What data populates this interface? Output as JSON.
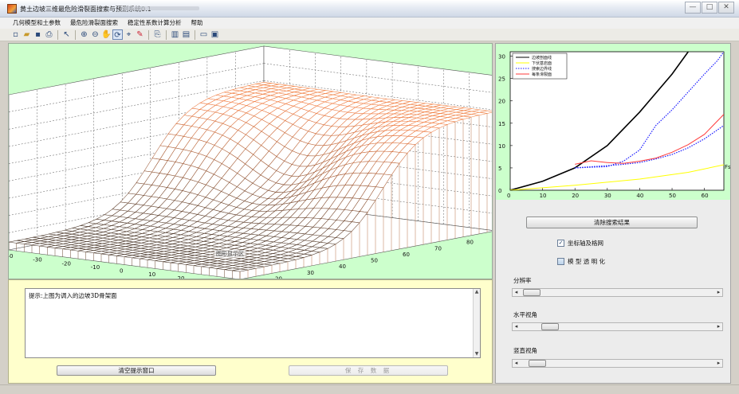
{
  "window": {
    "title": "黄土边坡三维最危险滑裂面搜索与预测系统0.1",
    "minimize": "—",
    "maximize": "□",
    "close": "✕"
  },
  "menu": [
    "几何模型和土参数",
    "最危险滑裂面搜索",
    "稳定性系数计算分析",
    "帮助"
  ],
  "toolbar": {
    "icons": [
      "new-file-icon",
      "open-folder-icon",
      "save-icon",
      "print-icon",
      "pointer-icon",
      "zoom-in-icon",
      "zoom-out-icon",
      "pan-icon",
      "rotate-3d-icon",
      "data-cursor-icon",
      "brush-icon",
      "link-icon",
      "colorbar-icon",
      "legend-icon",
      "hide-plot-tools-icon",
      "show-plot-tools-icon"
    ]
  },
  "plot3d": {
    "x_ticks": [
      "-40",
      "-30",
      "-20",
      "-10",
      "0",
      "10",
      "20",
      "30",
      "40"
    ],
    "y_ticks": [
      "10",
      "20",
      "30",
      "40",
      "50",
      "60",
      "70",
      "80",
      "90"
    ],
    "overlay_label": "图形显示区",
    "colors": {
      "mesh": "#b05a2a",
      "grid": "#333333",
      "background": "#ffffff"
    }
  },
  "plot2d": {
    "chart_data": {
      "type": "line",
      "xlim": [
        0,
        66
      ],
      "ylim": [
        0,
        31
      ],
      "x_ticks": [
        "0",
        "10",
        "20",
        "30",
        "40",
        "50",
        "60"
      ],
      "y_ticks": [
        "0",
        "5",
        "10",
        "15",
        "20",
        "25",
        "30"
      ],
      "grid": false,
      "legend_position": "top-left",
      "xlabel_partial": "Fs",
      "series": [
        {
          "name": "边坡剖面线",
          "color": "#000000",
          "dash": "solid",
          "x": [
            0,
            10,
            20,
            30,
            40,
            50,
            55
          ],
          "y": [
            0,
            2,
            5,
            10,
            17.5,
            26,
            31
          ]
        },
        {
          "name": "下伏基岩面",
          "color": "#ffff00",
          "dash": "solid",
          "x": [
            0,
            20,
            40,
            55,
            66
          ],
          "y": [
            0,
            1.1,
            2.5,
            4,
            5.7
          ]
        },
        {
          "name": "搜索边界线",
          "color": "#1a1aff",
          "dash": "dotted",
          "x": [
            20,
            30,
            35,
            40,
            45,
            50,
            55,
            60,
            64,
            66
          ],
          "y": [
            5,
            5.3,
            6.5,
            9,
            14.5,
            18,
            22,
            26,
            29,
            31
          ]
        },
        {
          "name": "每条滑裂面",
          "color": "#ff3b3b",
          "dash": "solid",
          "x": [
            20,
            25,
            30,
            35,
            40,
            45,
            50,
            55,
            60,
            66
          ],
          "y": [
            5.8,
            6.6,
            6.2,
            6.0,
            6.5,
            7.2,
            8.5,
            10.2,
            12.5,
            17
          ]
        },
        {
          "name": "",
          "color": "#1a1aff",
          "dash": "dotted",
          "x": [
            20,
            30,
            35,
            40,
            45,
            50,
            55,
            60,
            66
          ],
          "y": [
            5,
            5.5,
            5.8,
            6.2,
            7.0,
            8.0,
            9.5,
            11.5,
            14.5
          ]
        }
      ]
    }
  },
  "hint": {
    "text": "提示:上图为调入的边坡3D骨架面"
  },
  "buttons": {
    "clear_hint": "清空提示窗口",
    "save_data": "保 存 数 据",
    "clear_search": "清除搜索结果"
  },
  "options": {
    "axes_grid": {
      "label": "坐标轴及格网",
      "checked": true,
      "mark": "✓"
    },
    "transparent": {
      "label": "模 型 透 明 化",
      "checked": false
    }
  },
  "sliders": [
    {
      "name": "resolution",
      "label": "分辨率",
      "value": 0.02
    },
    {
      "name": "h-angle",
      "label": "水平视角",
      "value": 0.12
    },
    {
      "name": "v-angle",
      "label": "竖直视角",
      "value": 0.05
    }
  ]
}
